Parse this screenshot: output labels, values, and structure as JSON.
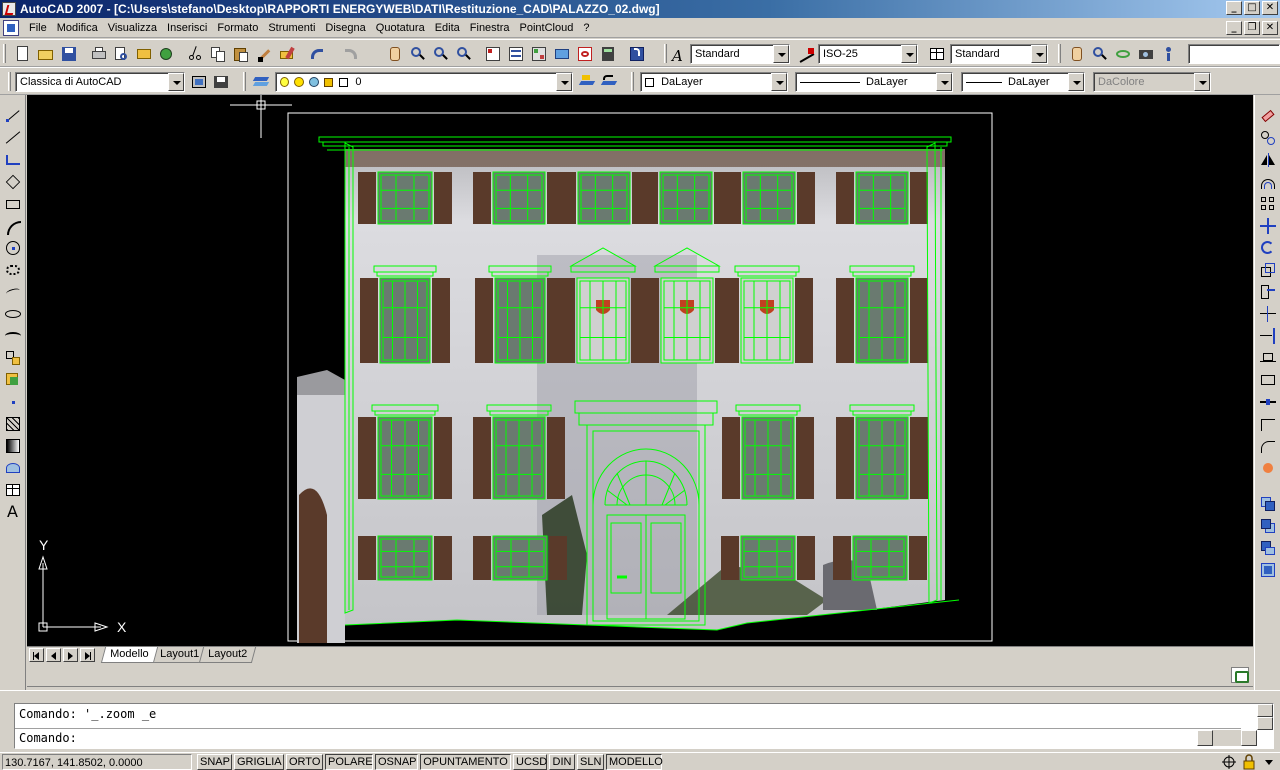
{
  "window": {
    "title": "AutoCAD 2007 - [C:\\Users\\stefano\\Desktop\\RAPPORTI ENERGYWEB\\DATI\\Restituzione_CAD\\PALAZZO_02.dwg]",
    "minimize": "_",
    "maximize": "□",
    "close": "✕",
    "doc_minimize": "_",
    "doc_restore": "❐",
    "doc_close": "✕"
  },
  "menu": {
    "items": [
      "File",
      "Modifica",
      "Visualizza",
      "Inserisci",
      "Formato",
      "Strumenti",
      "Disegna",
      "Quotatura",
      "Edita",
      "Finestra",
      "PointCloud",
      "?"
    ]
  },
  "toolbar_styles": {
    "text_style": "Standard",
    "dim_style": "ISO-25",
    "table_style": "Standard",
    "command_input": ""
  },
  "toolbar_layers": {
    "workspace": "Classica di AutoCAD",
    "current_layer": "0",
    "color": "DaLayer",
    "linetype": "DaLayer",
    "lineweight": "DaLayer",
    "plotstyle": "DaColore"
  },
  "colors": {
    "vector_green": "#00ff00",
    "viewport_bg": "#000000",
    "ui_face": "#d4d0c8"
  },
  "viewport": {
    "ucs_x_label": "X",
    "ucs_y_label": "Y"
  },
  "layout_tabs": [
    {
      "label": "Modello",
      "active": true
    },
    {
      "label": "Layout1",
      "active": false
    },
    {
      "label": "Layout2",
      "active": false
    }
  ],
  "command": {
    "history": "Comando: '_.zoom _e",
    "prompt": "Comando:"
  },
  "status": {
    "coordinates": "130.7167, 141.8502, 0.0000",
    "toggles": [
      {
        "label": "SNAP",
        "on": false
      },
      {
        "label": "GRIGLIA",
        "on": false
      },
      {
        "label": "ORTO",
        "on": false
      },
      {
        "label": "POLARE",
        "on": true
      },
      {
        "label": "OSNAP",
        "on": true
      },
      {
        "label": "OPUNTAMENTO",
        "on": true
      },
      {
        "label": "UCSD",
        "on": false
      },
      {
        "label": "DIN",
        "on": false
      },
      {
        "label": "SLN",
        "on": false
      },
      {
        "label": "MODELLO",
        "on": true
      }
    ]
  }
}
